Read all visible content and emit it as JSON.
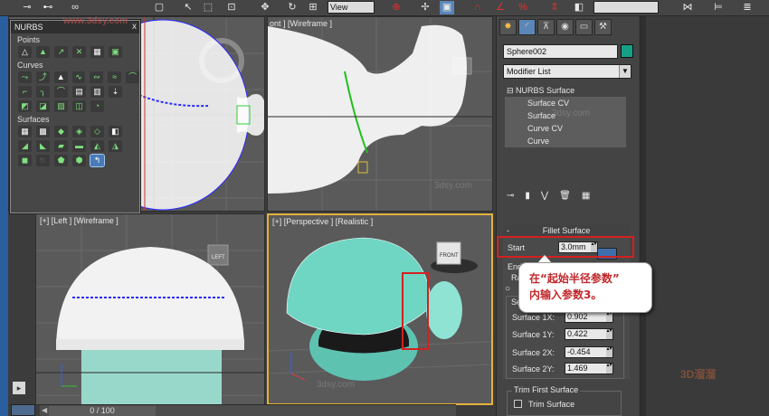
{
  "toolbar": {
    "view_dropdown": "View",
    "icons": [
      "link-icon",
      "unlink-icon",
      "bind-spacewarp-icon",
      "select-filter-icon",
      "select-object-icon",
      "select-by-name-icon",
      "rect-region-icon",
      "window-crossing-icon",
      "move-icon",
      "rotate-icon",
      "scale-icon",
      "reference-coord-icon",
      "pivot-icon",
      "select-manipulate-icon",
      "keyboard-shortcut-icon",
      "snaps-toggle-icon",
      "angle-snap-icon",
      "percent-snap-icon",
      "spinner-snap-icon",
      "named-selection-icon",
      "mirror-icon",
      "align-icon",
      "layer-manager-icon"
    ]
  },
  "nurbs_panel": {
    "title": "NURBS",
    "close": "x",
    "sections": [
      {
        "label": "Points",
        "rows": [
          [
            "point-icon",
            "offset-point-icon",
            "curve-point-icon",
            "curve-curve-point-icon",
            "surf-point-icon",
            "surf-curve-point-icon"
          ]
        ]
      },
      {
        "label": "Curves",
        "rows": [
          [
            "cv-curve-icon",
            "point-curve-icon",
            "fit-curve-icon",
            "transform-curve-icon",
            "blend-curve-icon",
            "offset-curve-icon",
            "mirror-curve-icon"
          ],
          [
            "chamfer-curve-icon",
            "fillet-curve-icon",
            "surf-surf-intersect-icon",
            "u-iso-curve-icon",
            "v-iso-curve-icon",
            "normal-projected-icon",
            "vector-projected-icon"
          ],
          [
            "cv-on-surf-icon",
            "point-on-surf-icon",
            "surf-offset-curve-icon",
            "surf-edge-curve-icon",
            "curve-extra-icon"
          ]
        ]
      },
      {
        "label": "Surfaces",
        "rows": [
          [
            "cv-surf-icon",
            "point-surf-icon",
            "transform-surf-icon",
            "blend-surf-icon",
            "offset-surf-icon",
            "mirror-surf-icon"
          ],
          [
            "extrude-surf-icon",
            "lathe-surf-icon",
            "ruled-surf-icon",
            "cap-surf-icon",
            "u-loft-icon",
            "uv-loft-icon"
          ],
          [
            "one-rail-sweep-icon",
            "two-rail-sweep-icon",
            "multi-sided-blend-icon",
            "multi-curve-trim-icon",
            "fillet-surf-icon"
          ]
        ]
      }
    ],
    "selected_tool": "fillet-surf-icon"
  },
  "viewports": {
    "top_left": {
      "label": ""
    },
    "top_right": {
      "label": "[+] [Front ] [Wireframe]",
      "visible_label": "ont ] [Wireframe ]"
    },
    "bottom_left": {
      "label": "[+] [Left ] [Wireframe ]"
    },
    "bottom_right": {
      "label": "[+] [Perspective ] [Realistic ]"
    },
    "viewcube_label": "LEFT",
    "viewcube_front": "FRONT"
  },
  "command_panel": {
    "tabs": [
      "create-tab",
      "modify-tab",
      "hierarchy-tab",
      "motion-tab",
      "display-tab",
      "utilities-tab"
    ],
    "object_name": "Sphere002",
    "object_color": "#16a085",
    "modifier_list": "Modifier List",
    "stack": {
      "root": "NURBS Surface",
      "items": [
        "Surface CV",
        "Surface",
        "Curve CV",
        "Curve"
      ]
    },
    "fillet_rollout": {
      "title": "Fillet Surface",
      "collapse": "-",
      "start_label": "Start",
      "start_value": "3.0mm",
      "end_label": "End",
      "radius_label": "Ra",
      "seed_label": "Se",
      "seeds": [
        {
          "label": "Surface 1X:",
          "value": "0.902"
        },
        {
          "label": "Surface 1Y:",
          "value": "0.422"
        },
        {
          "label": "Surface 2X:",
          "value": "-0.454"
        },
        {
          "label": "Surface 2Y:",
          "value": "1.469"
        }
      ]
    },
    "trim_rollout": {
      "title": "Trim First Surface",
      "checkbox_label": "Trim Surface",
      "checked": false
    }
  },
  "time_slider": {
    "label": "0 / 100"
  },
  "annotation": {
    "line1": "在“起始半径参数”",
    "line2": "内输入参数3。"
  },
  "watermarks": [
    "www.3dsy.com",
    "3dsy.com",
    "3dsy.com",
    "3dsy.com"
  ]
}
